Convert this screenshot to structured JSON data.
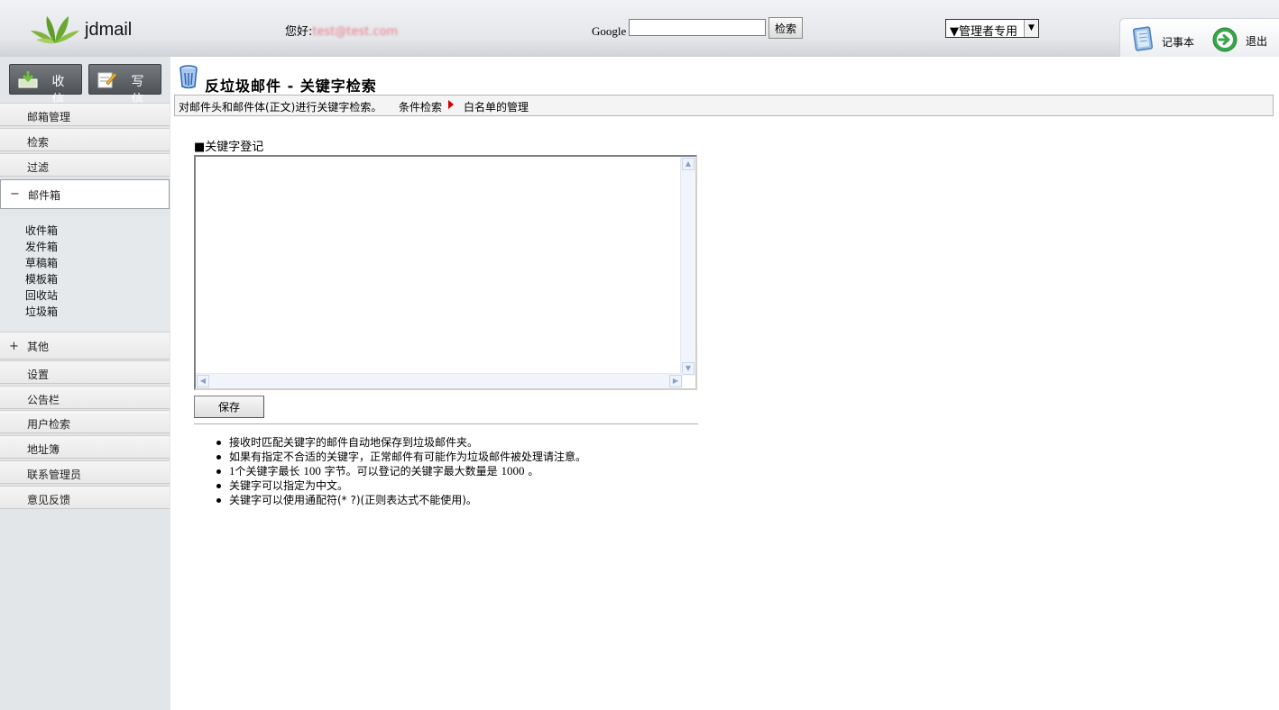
{
  "header": {
    "app_name": "jdmail",
    "greeting_label": "您好:",
    "greeting_user": "test@test.com",
    "search_label": "Google",
    "search_value": "",
    "search_button": "检索",
    "role_select": "▼管理者专用",
    "notepad_label": "记事本",
    "logout_label": "退出"
  },
  "sidebar": {
    "receive_button": "收 信",
    "compose_button": "写 信",
    "nav": {
      "mailbox_manage": "邮箱管理",
      "search": "检索",
      "filter": "过滤",
      "mailbox": "邮件箱",
      "mailbox_sign": "−",
      "other": "其他",
      "other_sign": "+",
      "settings": "设置",
      "bulletin": "公告栏",
      "user_search": "用户检索",
      "address_book": "地址簿",
      "contact_admin": "联系管理员",
      "feedback": "意见反馈"
    },
    "folders": [
      "收件箱",
      "发件箱",
      "草稿箱",
      "模板箱",
      "回收站",
      "垃圾箱"
    ]
  },
  "main": {
    "title": "反垃圾邮件 - 关键字检索",
    "toolbar": {
      "description": "对邮件头和邮件体(正文)进行关键字检索。",
      "condition_search": "条件检索",
      "whitelist": "白名单的管理"
    },
    "section_label": "■关键字登记",
    "keywords_value": "",
    "save_button": "保存",
    "notes": {
      "n1": "接收时匹配关键字的邮件自动地保存到垃圾邮件夹。",
      "n2": "如果有指定不合适的关键字，正常邮件有可能作为垃圾邮件被处理请注意。",
      "n3_a": "1",
      "n3_b": "个关键字最长",
      "n3_c": "100",
      "n3_d": "字节。可以登记的关键字最大数量是",
      "n3_e": "1000",
      "n3_f": "。",
      "n4": "关键字可以指定为中文。",
      "n5": "关键字可以使用通配符(* ?)(正则表达式不能使用)。"
    }
  }
}
